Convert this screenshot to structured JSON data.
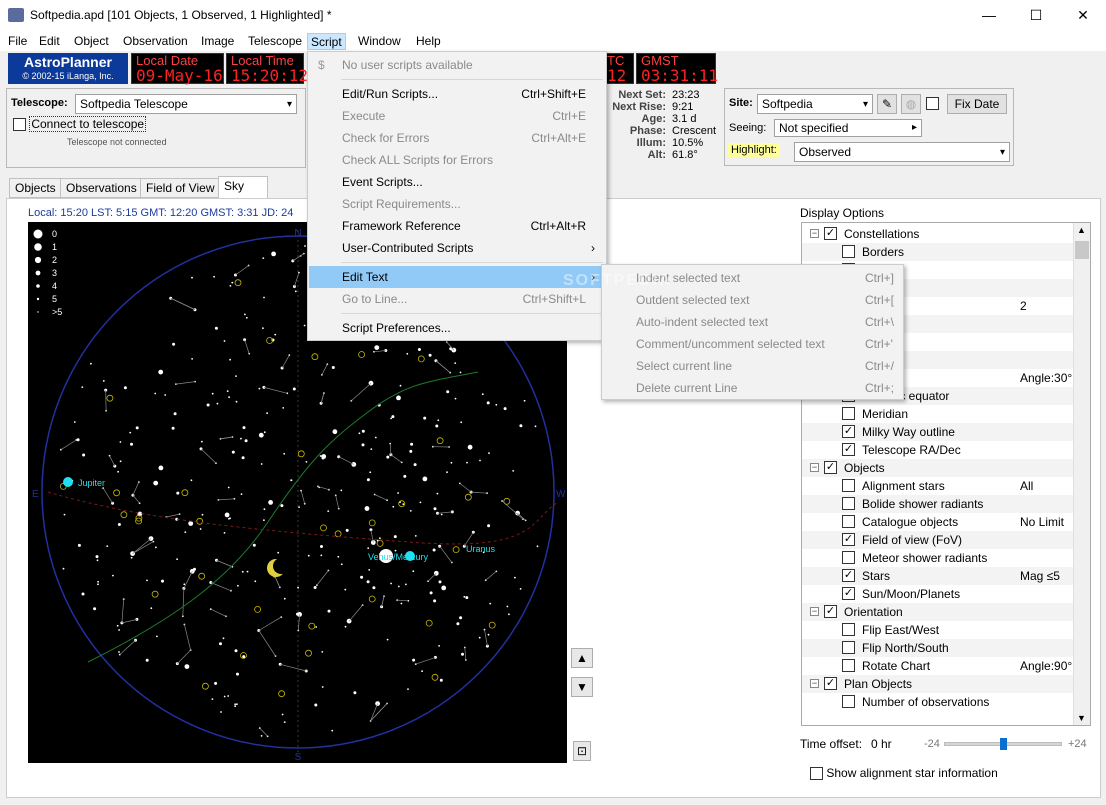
{
  "window": {
    "title": "Softpedia.apd [101 Objects, 1 Observed, 1 Highlighted] *",
    "minimize": "—",
    "maximize": "☐",
    "close": "✕"
  },
  "menubar": [
    "File",
    "Edit",
    "Object",
    "Observation",
    "Image",
    "Telescope",
    "Script",
    "Window",
    "Help"
  ],
  "logo": {
    "name": "AstroPlanner",
    "copyright": "© 2002-15 iLanga, Inc."
  },
  "clocks": {
    "local_date_label": "Local Date",
    "local_date": "09-May-16",
    "local_time_label": "Local Time",
    "local_time": "15:20:12",
    "utc_label": "TC",
    "utc": "12",
    "gmst_label": "GMST",
    "gmst": "03:31:11"
  },
  "telescope": {
    "label": "Telescope:",
    "value": "Softpedia Telescope",
    "connect": "Connect to telescope",
    "status": "Telescope not connected"
  },
  "moon": {
    "labels": [
      "Next Set:",
      "Next Rise:",
      "Age:",
      "Phase:",
      "Illum:",
      "Alt:"
    ],
    "values": [
      "23:23",
      "9:21",
      "3.1 d",
      "Crescent",
      "10.5%",
      "61.8°"
    ]
  },
  "site": {
    "label": "Site:",
    "value": "Softpedia",
    "fix_date": "Fix Date",
    "seeing_label": "Seeing:",
    "seeing_value": "Not specified",
    "highlight_label": "Highlight:",
    "highlight_value": "Observed"
  },
  "tabs": [
    "Objects",
    "Observations",
    "Field of View",
    "Sky"
  ],
  "sky": {
    "infoline": "Local: 15:20   LST: 5:15   GMT: 12:20   GMST: 3:31   JD: 24",
    "legend": [
      "0",
      "1",
      "2",
      "3",
      "4",
      "5",
      ">5"
    ],
    "labels": {
      "jupiter": "Jupiter",
      "venus_mercury": "Venus/Mercury",
      "uranus": "Uranus",
      "north": "N",
      "south": "S",
      "east": "E",
      "west": "W"
    }
  },
  "display_options": {
    "title": "Display Options",
    "rows": [
      {
        "level": 0,
        "text": "Constellations",
        "checked": true,
        "expander": "−"
      },
      {
        "level": 1,
        "text": "Borders",
        "checked": false
      },
      {
        "level": 1,
        "text": "",
        "checked": false
      },
      {
        "level": 1,
        "text": "",
        "checked": false
      },
      {
        "level": 1,
        "text": "",
        "checked": false,
        "val": "2"
      },
      {
        "level": 1,
        "text": "h grid",
        "checked": false
      },
      {
        "level": 1,
        "text": "",
        "checked": false
      },
      {
        "level": 1,
        "text": "grid",
        "checked": false
      },
      {
        "level": 1,
        "text": "ude",
        "checked": false,
        "val": "Angle:30°"
      },
      {
        "level": 1,
        "text": "Galactic equator",
        "checked": false
      },
      {
        "level": 1,
        "text": "Meridian",
        "checked": false
      },
      {
        "level": 1,
        "text": "Milky Way outline",
        "checked": true
      },
      {
        "level": 1,
        "text": "Telescope RA/Dec",
        "checked": true
      },
      {
        "level": 0,
        "text": "Objects",
        "checked": true,
        "expander": "−"
      },
      {
        "level": 1,
        "text": "Alignment stars",
        "checked": false,
        "val": "All"
      },
      {
        "level": 1,
        "text": "Bolide shower radiants",
        "checked": false
      },
      {
        "level": 1,
        "text": "Catalogue objects",
        "checked": false,
        "val": "No Limit"
      },
      {
        "level": 1,
        "text": "Field of view (FoV)",
        "checked": true
      },
      {
        "level": 1,
        "text": "Meteor shower radiants",
        "checked": false
      },
      {
        "level": 1,
        "text": "Stars",
        "checked": true,
        "val": "Mag ≤5"
      },
      {
        "level": 1,
        "text": "Sun/Moon/Planets",
        "checked": true
      },
      {
        "level": 0,
        "text": "Orientation",
        "checked": true,
        "expander": "−"
      },
      {
        "level": 1,
        "text": "Flip East/West",
        "checked": false
      },
      {
        "level": 1,
        "text": "Flip North/South",
        "checked": false
      },
      {
        "level": 1,
        "text": "Rotate Chart",
        "checked": false,
        "val": "Angle:90°"
      },
      {
        "level": 0,
        "text": "Plan Objects",
        "checked": true,
        "expander": "−"
      },
      {
        "level": 1,
        "text": "Number of observations",
        "checked": false
      }
    ]
  },
  "time_offset": {
    "label": "Time offset:",
    "value": "0 hr",
    "min": "-24",
    "max": "+24",
    "fraction": 0.5
  },
  "show_alignment": "Show alignment star information",
  "script_menu": [
    {
      "label": "No user scripts available",
      "shortcut": "",
      "disabled": true
    },
    {
      "sep": true
    },
    {
      "label": "Edit/Run Scripts...",
      "shortcut": "Ctrl+Shift+E"
    },
    {
      "label": "Execute",
      "shortcut": "Ctrl+E",
      "disabled": true
    },
    {
      "label": "Check for Errors",
      "shortcut": "Ctrl+Alt+E",
      "disabled": true
    },
    {
      "label": "Check ALL Scripts for Errors",
      "shortcut": "",
      "disabled": true
    },
    {
      "label": "Event Scripts...",
      "shortcut": ""
    },
    {
      "label": "Script Requirements...",
      "shortcut": "",
      "disabled": true
    },
    {
      "label": "Framework Reference",
      "shortcut": "Ctrl+Alt+R"
    },
    {
      "label": "User-Contributed Scripts",
      "shortcut": "›"
    },
    {
      "sep": true
    },
    {
      "label": "Edit Text",
      "shortcut": "›",
      "highlight": true
    },
    {
      "label": "Go to Line...",
      "shortcut": "Ctrl+Shift+L",
      "disabled": true
    },
    {
      "sep": true
    },
    {
      "label": "Script Preferences...",
      "shortcut": ""
    }
  ],
  "edit_text_menu": [
    {
      "label": "Indent selected text",
      "shortcut": "Ctrl+]"
    },
    {
      "label": "Outdent selected text",
      "shortcut": "Ctrl+["
    },
    {
      "label": "Auto-indent selected text",
      "shortcut": "Ctrl+\\"
    },
    {
      "label": "Comment/uncomment selected text",
      "shortcut": "Ctrl+'"
    },
    {
      "label": "Select current line",
      "shortcut": "Ctrl+/"
    },
    {
      "label": "Delete current Line",
      "shortcut": "Ctrl+;"
    }
  ],
  "watermark": "SOFTPEDIA"
}
